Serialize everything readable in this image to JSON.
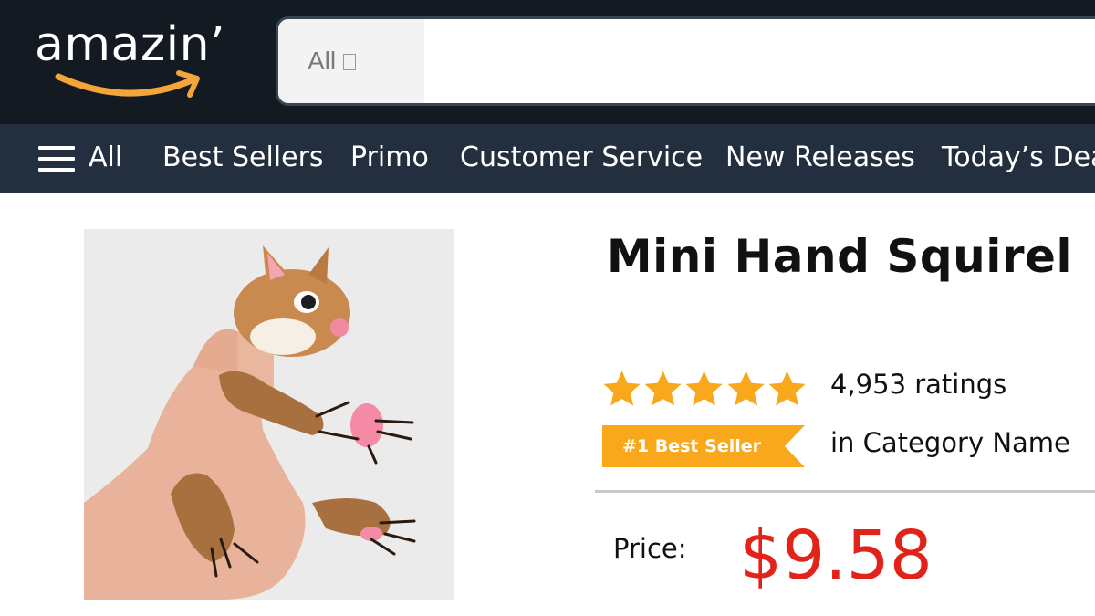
{
  "header": {
    "logo_text": "amazin’",
    "search": {
      "department": "All",
      "placeholder": ""
    }
  },
  "nav": {
    "menu_label": "All",
    "items": [
      {
        "label": "Best Sellers"
      },
      {
        "label": "Primo"
      },
      {
        "label": "Customer Service"
      },
      {
        "label": "New Releases"
      },
      {
        "label": "Today’s Deals"
      }
    ]
  },
  "product": {
    "image_alt": "hand-squirrel-puppet-image",
    "title": "Mini Hand Squirel",
    "rating_stars": 5,
    "ratings_count": "4,953 ratings",
    "badge": "#1 Best Seller",
    "category": "in Category Name",
    "price_label": "Price:",
    "price": "$9.58"
  },
  "colors": {
    "header_bg": "#131a22",
    "nav_bg": "#232f3e",
    "star": "#f9a81b",
    "badge": "#f9a81b",
    "price": "#e2231a"
  }
}
